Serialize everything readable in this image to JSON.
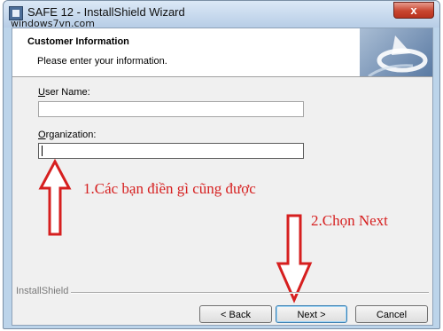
{
  "window": {
    "title": "SAFE 12 - InstallShield Wizard",
    "watermark": "windows7vn.com",
    "close_label": "x"
  },
  "header": {
    "title": "Customer Information",
    "subtitle": "Please enter your information."
  },
  "form": {
    "user_name_label_key": "U",
    "user_name_label_rest": "ser Name:",
    "user_name_value": "",
    "organization_label_key": "O",
    "organization_label_rest": "rganization:",
    "organization_value": ""
  },
  "annotations": {
    "note1": "1.Các bạn điền gì cũng được",
    "note2": "2.Chọn Next",
    "color": "#d61f1f"
  },
  "footer": {
    "brand": "InstallShield",
    "back_label": "< Back",
    "next_label": "Next >",
    "cancel_label": "Cancel"
  }
}
